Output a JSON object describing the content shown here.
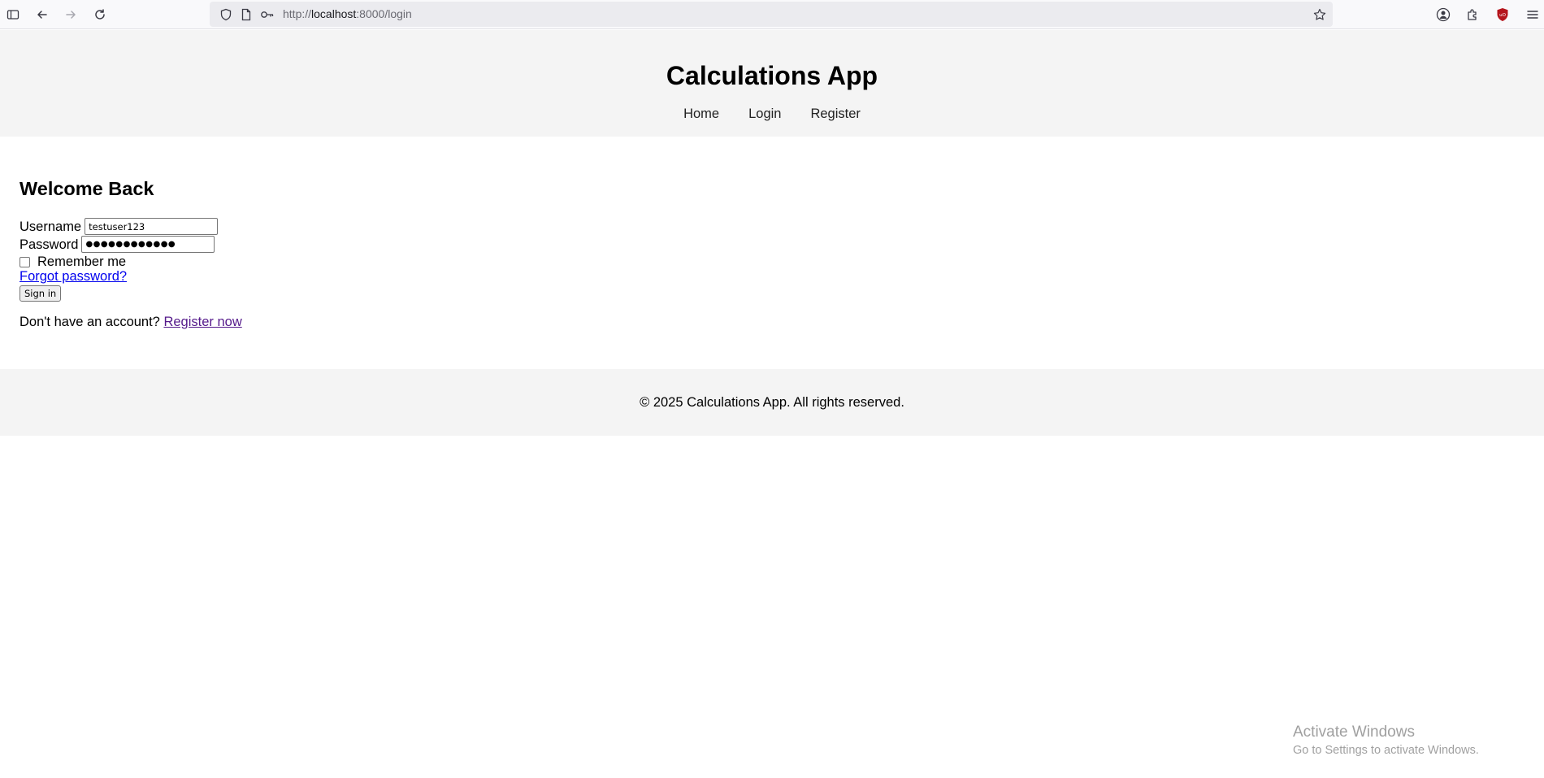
{
  "browser": {
    "url_prefix": "http://",
    "url_host": "localhost",
    "url_rest": ":8000/login",
    "icons": [
      "sidebar-icon",
      "back-icon",
      "forward-icon",
      "reload-icon",
      "shield-icon",
      "page-icon",
      "key-icon",
      "bookmark-star-icon",
      "account-icon",
      "extensions-icon",
      "ublock-icon",
      "menu-icon"
    ]
  },
  "header": {
    "title": "Calculations App",
    "nav": [
      "Home",
      "Login",
      "Register"
    ]
  },
  "login": {
    "heading": "Welcome Back",
    "username_label": "Username",
    "username_value": "testuser123",
    "password_label": "Password",
    "password_value": "●●●●●●●●●●●●",
    "remember_label": "Remember me",
    "forgot_link": "Forgot password?",
    "signin_button": "Sign in",
    "register_prompt": "Don't have an account?",
    "register_link": "Register now"
  },
  "footer": {
    "text": "© 2025 Calculations App. All rights reserved."
  },
  "watermark": {
    "title": "Activate Windows",
    "subtitle": "Go to Settings to activate Windows."
  },
  "colors": {
    "header_bg": "#f4f4f4",
    "link": "#0000ee",
    "visited_link": "#551a8b",
    "ublock_red": "#b5151c"
  }
}
